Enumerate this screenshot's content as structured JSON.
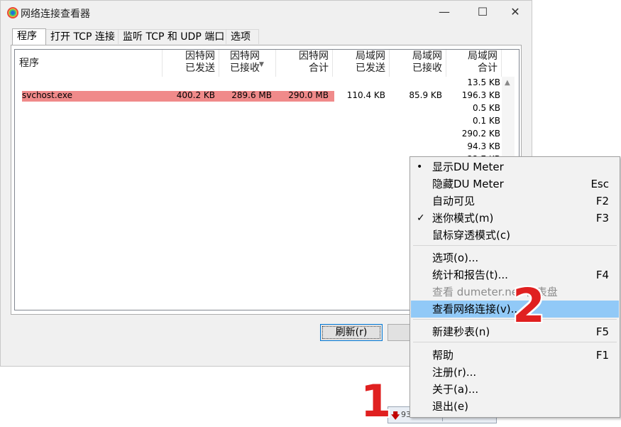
{
  "window": {
    "title": "网络连接查看器"
  },
  "window_controls": {
    "minimize": "—",
    "maximize": "☐",
    "close": "✕"
  },
  "tabs": [
    {
      "label": "程序"
    },
    {
      "label": "打开 TCP 连接"
    },
    {
      "label": "监听 TCP 和 UDP 端口"
    },
    {
      "label": "选项"
    }
  ],
  "columns": [
    {
      "line1": "程序",
      "line2": ""
    },
    {
      "line1": "因特网",
      "line2": "已发送"
    },
    {
      "line1": "因特网",
      "line2": "已接收"
    },
    {
      "line1": "因特网",
      "line2": "合计"
    },
    {
      "line1": "局域网",
      "line2": "已发送"
    },
    {
      "line1": "局域网",
      "line2": "已接收"
    },
    {
      "line1": "局域网",
      "line2": "合计"
    }
  ],
  "rows": [
    {
      "name": "svchost.exe",
      "inet_sent": "400.2 KB",
      "inet_recv": "289.6 MB",
      "inet_total": "290.0 MB",
      "lan_sent": "110.4 KB",
      "lan_recv": "85.9 KB"
    }
  ],
  "lan_total_column": [
    "13.5 KB",
    "196.3 KB",
    "0.5 KB",
    "0.1 KB",
    "290.2 KB",
    "94.3 KB",
    "22.7 KB"
  ],
  "buttons": {
    "refresh": "刷新(r)",
    "second_partial": ""
  },
  "tray": {
    "value_partial": "93"
  },
  "context_menu": [
    {
      "label": "显示DU Meter",
      "shortcut": "",
      "mark": "•"
    },
    {
      "label": "隐藏DU Meter",
      "shortcut": "Esc",
      "mark": ""
    },
    {
      "label": "自动可见",
      "shortcut": "F2",
      "mark": ""
    },
    {
      "label": "迷你模式(m)",
      "shortcut": "F3",
      "mark": "✓"
    },
    {
      "label": "鼠标穿透模式(c)",
      "shortcut": "",
      "mark": ""
    },
    {
      "label": "选项(o)...",
      "shortcut": "",
      "mark": ""
    },
    {
      "label": "统计和报告(t)...",
      "shortcut": "F4",
      "mark": ""
    },
    {
      "label": "查看 dumeter.net 仪表盘",
      "shortcut": "",
      "mark": ""
    },
    {
      "label": "查看网络连接(v)...",
      "shortcut": "",
      "mark": ""
    },
    {
      "label": "新建秒表(n)",
      "shortcut": "F5",
      "mark": ""
    },
    {
      "label": "帮助",
      "shortcut": "F1",
      "mark": ""
    },
    {
      "label": "注册(r)...",
      "shortcut": "",
      "mark": ""
    },
    {
      "label": "关于(a)...",
      "shortcut": "",
      "mark": ""
    },
    {
      "label": "退出(e)",
      "shortcut": "",
      "mark": ""
    }
  ],
  "annotations": {
    "step1": "1",
    "step2": "2"
  },
  "colors": {
    "highlight_row": "#f08a8a",
    "menu_hover": "#91c9f7",
    "annotation": "#e02020"
  }
}
